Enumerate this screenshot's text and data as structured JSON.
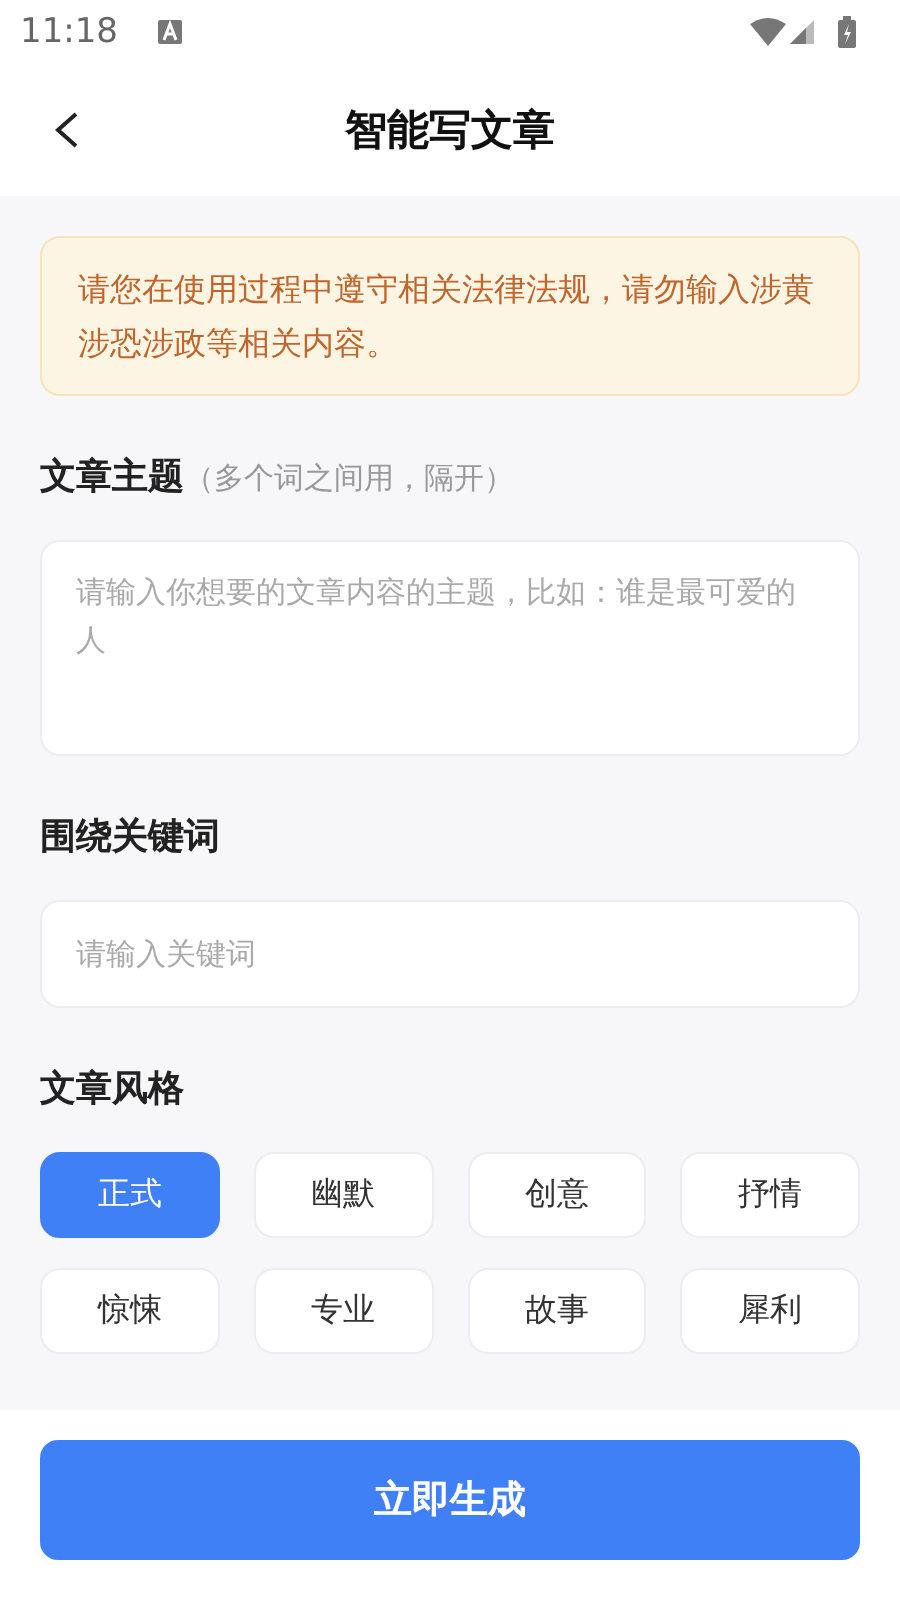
{
  "status_bar": {
    "time": "11:18"
  },
  "header": {
    "title": "智能写文章"
  },
  "notice": {
    "text": "请您在使用过程中遵守相关法律法规，请勿输入涉黄涉恐涉政等相关内容。"
  },
  "topic": {
    "label": "文章主题",
    "hint": "（多个词之间用，隔开）",
    "placeholder": "请输入你想要的文章内容的主题，比如：谁是最可爱的人"
  },
  "keywords": {
    "label": "围绕关键词",
    "placeholder": "请输入关键词"
  },
  "style": {
    "label": "文章风格",
    "options": [
      {
        "label": "正式",
        "selected": true
      },
      {
        "label": "幽默",
        "selected": false
      },
      {
        "label": "创意",
        "selected": false
      },
      {
        "label": "抒情",
        "selected": false
      },
      {
        "label": "惊悚",
        "selected": false
      },
      {
        "label": "专业",
        "selected": false
      },
      {
        "label": "故事",
        "selected": false
      },
      {
        "label": "犀利",
        "selected": false
      }
    ]
  },
  "generate_button": {
    "label": "立即生成"
  }
}
